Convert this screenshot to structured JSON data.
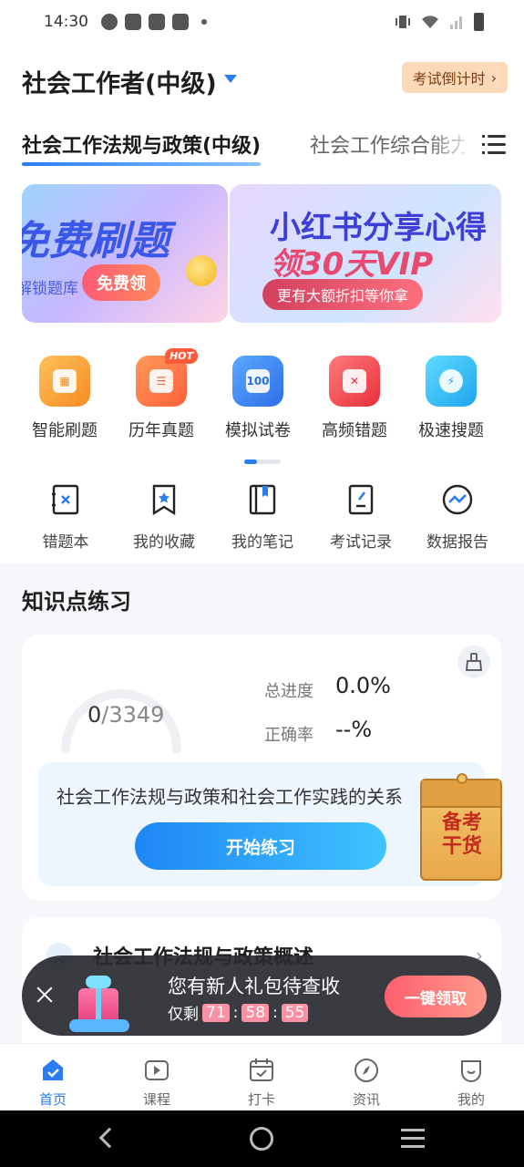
{
  "status_bar": {
    "time": "14:30"
  },
  "header": {
    "title": "社会工作者(中级)",
    "countdown_label": "考试倒计时"
  },
  "tabs": [
    {
      "label": "社会工作法规与政策(中级)",
      "active": true
    },
    {
      "label": "社会工作综合能力(中级)",
      "active": false
    }
  ],
  "banners": {
    "left": {
      "headline": "免费刷题",
      "sub": "解锁题库",
      "button": "免费领"
    },
    "right": {
      "line1": "小红书分享心得",
      "line2": "领30天VIP",
      "button": "更有大额折扣等你拿"
    }
  },
  "main_tools": [
    {
      "label": "智能刷题",
      "icon": "smart-practice-icon",
      "color": "#f7a53a"
    },
    {
      "label": "历年真题",
      "icon": "past-exams-icon",
      "color": "#ff7a45",
      "badge": "HOT"
    },
    {
      "label": "模拟试卷",
      "icon": "mock-paper-icon",
      "color": "#3f8cf5",
      "inner": "100"
    },
    {
      "label": "高频错题",
      "icon": "frequent-errors-icon",
      "color": "#f2454f"
    },
    {
      "label": "极速搜题",
      "icon": "quick-search-icon",
      "color": "#27b8f0"
    }
  ],
  "secondary_tools": [
    {
      "label": "错题本",
      "icon": "mistake-book-icon"
    },
    {
      "label": "我的收藏",
      "icon": "bookmark-icon"
    },
    {
      "label": "我的笔记",
      "icon": "notebook-icon"
    },
    {
      "label": "考试记录",
      "icon": "exam-record-icon"
    },
    {
      "label": "数据报告",
      "icon": "data-report-icon"
    }
  ],
  "knowledge": {
    "section_title": "知识点练习",
    "done": "0",
    "total": "/3349",
    "progress_label": "总进度",
    "progress_value": "0.0%",
    "accuracy_label": "正确率",
    "accuracy_value": "--%",
    "topic": "社会工作法规与政策和社会工作实践的关系",
    "start_button": "开始练习",
    "next_chapter": "社会工作法规与政策概述"
  },
  "float_badge": {
    "line1": "备考",
    "line2": "干货"
  },
  "gift_toast": {
    "title": "您有新人礼包待查收",
    "remain_prefix": "仅剩",
    "hours": "71",
    "minutes": "58",
    "seconds": "55",
    "button": "一键领取"
  },
  "bottom_nav": [
    {
      "label": "首页",
      "active": true
    },
    {
      "label": "课程",
      "active": false
    },
    {
      "label": "打卡",
      "active": false
    },
    {
      "label": "资讯",
      "active": false
    },
    {
      "label": "我的",
      "active": false
    }
  ],
  "colors": {
    "accent": "#2a7cf0",
    "claim": "#ff5f6d"
  }
}
